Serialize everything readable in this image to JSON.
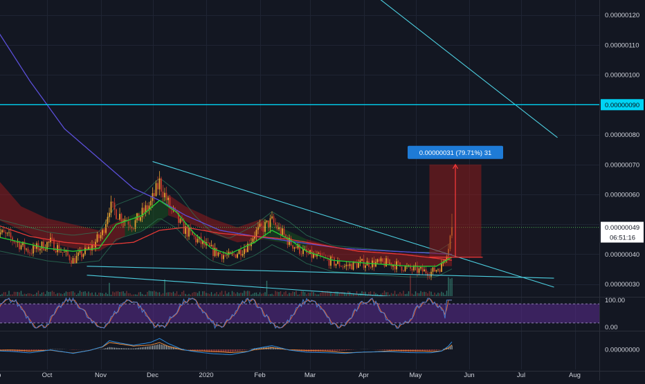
{
  "colors": {
    "background": "#131722",
    "grid": "#1f2433",
    "axis_text": "#d1d4dc",
    "up_candle": "#e8a030",
    "down_candle": "#c0392b",
    "trendline": "#4dd0e1",
    "horizontal_level": "#00d4f5",
    "sma_fast": "#26c935",
    "sma_mid": "#e53935",
    "sma_slow": "#5b4fd8",
    "ichimoku_cloud_red": "#b71c1c",
    "ichimoku_cloud_green": "#1b5e20",
    "price_label_bg": "#ffffff",
    "measure_box": "#8e1b1b",
    "measure_label_bg": "#1e7bd6",
    "stoch_band": "#5b2c8f",
    "stoch_k": "#4a7bd0",
    "stoch_d": "#e0693a",
    "macd_line": "#2f8ee0",
    "macd_signal": "#e88a3a"
  },
  "chart_data": {
    "type": "candlestick",
    "x_ticks": [
      "Sep",
      "Oct",
      "Nov",
      "Dec",
      "2020",
      "Feb",
      "Mar",
      "Apr",
      "May",
      "Jun",
      "Jul",
      "Aug"
    ],
    "x_tick_days": [
      0,
      30,
      61,
      91,
      122,
      153,
      182,
      213,
      243,
      274,
      304,
      335
    ],
    "y_ticks": [
      "0.00000030",
      "0.00000040",
      "0.00000050",
      "0.00000060",
      "0.00000070",
      "0.00000080",
      "0.00000090",
      "0.00000100",
      "0.00000110",
      "0.00000120"
    ],
    "y_tick_values": [
      30,
      40,
      50,
      60,
      70,
      80,
      90,
      100,
      110,
      120
    ],
    "ylim": [
      26,
      125
    ],
    "grid": true,
    "price_keypoints": [
      [
        0,
        48
      ],
      [
        10,
        45
      ],
      [
        20,
        41
      ],
      [
        32,
        44
      ],
      [
        45,
        38
      ],
      [
        55,
        42
      ],
      [
        62,
        47
      ],
      [
        66,
        56
      ],
      [
        72,
        53
      ],
      [
        80,
        50
      ],
      [
        90,
        57
      ],
      [
        95,
        64
      ],
      [
        100,
        57
      ],
      [
        108,
        49
      ],
      [
        116,
        45
      ],
      [
        126,
        41
      ],
      [
        136,
        39
      ],
      [
        146,
        43
      ],
      [
        150,
        47
      ],
      [
        160,
        51
      ],
      [
        170,
        44
      ],
      [
        180,
        40
      ],
      [
        192,
        38
      ],
      [
        202,
        36
      ],
      [
        213,
        37
      ],
      [
        228,
        37
      ],
      [
        240,
        35
      ],
      [
        252,
        34
      ],
      [
        258,
        36
      ],
      [
        262,
        43
      ],
      [
        264,
        49
      ]
    ],
    "sma_slow_keypoints": [
      [
        0,
        116
      ],
      [
        20,
        98
      ],
      [
        40,
        82
      ],
      [
        60,
        72
      ],
      [
        80,
        62
      ],
      [
        95,
        58
      ],
      [
        110,
        53
      ],
      [
        130,
        48
      ],
      [
        150,
        46
      ],
      [
        175,
        44
      ],
      [
        200,
        42
      ],
      [
        230,
        41
      ],
      [
        264,
        40
      ]
    ],
    "sma_mid_keypoints": [
      [
        0,
        50
      ],
      [
        20,
        46
      ],
      [
        40,
        44
      ],
      [
        60,
        43
      ],
      [
        80,
        44
      ],
      [
        95,
        48
      ],
      [
        110,
        49
      ],
      [
        130,
        47
      ],
      [
        150,
        46
      ],
      [
        170,
        45
      ],
      [
        190,
        43
      ],
      [
        210,
        41
      ],
      [
        235,
        40
      ],
      [
        264,
        38
      ]
    ],
    "sma_fast_keypoints": [
      [
        0,
        46
      ],
      [
        15,
        44
      ],
      [
        30,
        42
      ],
      [
        45,
        41
      ],
      [
        60,
        42
      ],
      [
        70,
        50
      ],
      [
        85,
        53
      ],
      [
        95,
        58
      ],
      [
        105,
        54
      ],
      [
        115,
        47
      ],
      [
        125,
        42
      ],
      [
        135,
        40
      ],
      [
        150,
        44
      ],
      [
        160,
        48
      ],
      [
        170,
        45
      ],
      [
        180,
        41
      ],
      [
        195,
        38
      ],
      [
        215,
        37
      ],
      [
        240,
        36
      ],
      [
        255,
        36
      ],
      [
        264,
        39
      ]
    ],
    "cloud_keypoints": [
      [
        0,
        52,
        66
      ],
      [
        15,
        48,
        56
      ],
      [
        30,
        44,
        52
      ],
      [
        45,
        42,
        50
      ],
      [
        60,
        41,
        48
      ],
      [
        75,
        46,
        52
      ],
      [
        90,
        49,
        56
      ],
      [
        100,
        53,
        60
      ],
      [
        110,
        51,
        56
      ],
      [
        125,
        47,
        52
      ],
      [
        140,
        44,
        49
      ],
      [
        155,
        45,
        52
      ],
      [
        165,
        44,
        49
      ],
      [
        180,
        41,
        45
      ],
      [
        200,
        38,
        42
      ],
      [
        220,
        37,
        41
      ],
      [
        245,
        36,
        40
      ],
      [
        264,
        36,
        39
      ]
    ],
    "trendlines": [
      {
        "points": [
          [
            91,
            71
          ],
          [
            323,
            29
          ]
        ]
      },
      {
        "points": [
          [
            53,
            36
          ],
          [
            323,
            32
          ]
        ]
      },
      {
        "points": [
          [
            53,
            33
          ],
          [
            300,
            23
          ]
        ]
      },
      {
        "points": [
          [
            172,
            148
          ],
          [
            325,
            79
          ]
        ]
      }
    ],
    "horizontal_level": 90,
    "last_price": 49,
    "current_price_label": "0.00000049",
    "countdown": "06:51:16",
    "level_label": "0.00000090",
    "measure": {
      "label": "0.00000031 (79.71%) 31",
      "x_start": 251,
      "x_end": 281,
      "price_low": 39,
      "price_high": 70
    },
    "volume_axis_max": 10,
    "stochastic": {
      "y_ticks": [
        "100.00",
        "0.00"
      ],
      "band": [
        20,
        80
      ],
      "ylim": [
        0,
        100
      ]
    },
    "macd": {
      "y_ticks": [
        "0.00000000"
      ]
    }
  }
}
